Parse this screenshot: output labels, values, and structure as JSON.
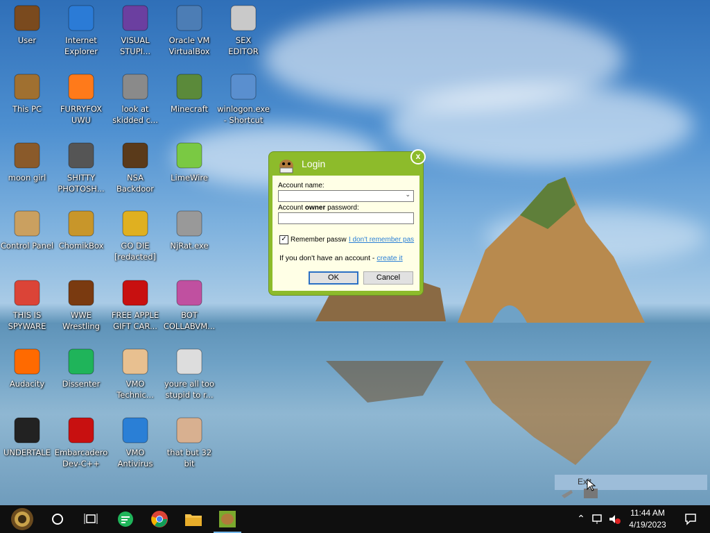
{
  "desktop_icons": [
    {
      "label": "User"
    },
    {
      "label": "Internet\nExplorer"
    },
    {
      "label": "VISUAL\nSTUPI..."
    },
    {
      "label": "Oracle VM\nVirtualBox"
    },
    {
      "label": "SEX\nEDITOR"
    },
    {
      "label": "This PC"
    },
    {
      "label": "FURRYFOX\nUWU"
    },
    {
      "label": "look at\nskidded c..."
    },
    {
      "label": "Minecraft"
    },
    {
      "label": "winlogon.exe\n- Shortcut"
    },
    {
      "label": "moon girl"
    },
    {
      "label": "SHITTY\nPHOTOSH..."
    },
    {
      "label": "NSA\nBackdoor"
    },
    {
      "label": "LimeWire"
    },
    {
      "label": "Control Panel"
    },
    {
      "label": "ChomikBox"
    },
    {
      "label": "GO DIE\n[redacted]"
    },
    {
      "label": "NjRat.exe"
    },
    {
      "label": "THIS IS\nSPYWARE"
    },
    {
      "label": "WWE\nWrestling"
    },
    {
      "label": "FREE APPLE\nGIFT CAR..."
    },
    {
      "label": "BOT\nCOLLABVM..."
    },
    {
      "label": "Audacity"
    },
    {
      "label": "Dissenter"
    },
    {
      "label": "VMO\nTechnic..."
    },
    {
      "label": "youre all too\nstupid to r..."
    },
    {
      "label": "UNDERTALE"
    },
    {
      "label": "Embarcadero\nDev-C++"
    },
    {
      "label": "VMO\nAntivirus"
    },
    {
      "label": "that but 32\nbit"
    }
  ],
  "dialog": {
    "title": "Login",
    "close": "x",
    "account_name_label": "Account name:",
    "account_name_value": "",
    "password_label_pre": "Account ",
    "password_label_bold": "owner",
    "password_label_post": " password:",
    "password_value": "",
    "remember_label": "Remember passw",
    "remember_checked": true,
    "forgot_link": "I don't remember pas",
    "no_account_text": "If you don't have an account - ",
    "create_link": "create it",
    "ok_label": "OK",
    "cancel_label": "Cancel"
  },
  "tray_tooltip": {
    "label": "Exit"
  },
  "taskbar": {
    "time": "11:44 AM",
    "date": "4/19/2023"
  }
}
